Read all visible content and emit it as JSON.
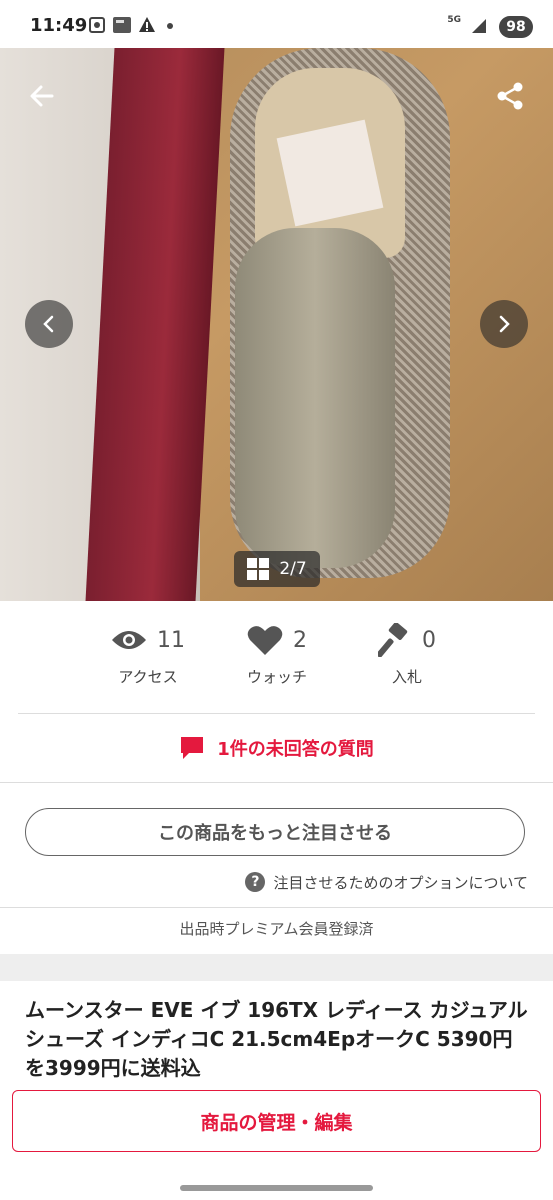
{
  "status_bar": {
    "time": "11:49",
    "network": "5G",
    "battery": "98"
  },
  "gallery": {
    "counter": "2/7",
    "icons": {
      "back": "arrow-left-icon",
      "share": "share-icon",
      "prev": "chevron-left-icon",
      "next": "chevron-right-icon",
      "grid": "grid-icon"
    }
  },
  "stats": {
    "access": {
      "count": "11",
      "label": "アクセス",
      "icon": "eye-icon"
    },
    "watch": {
      "count": "2",
      "label": "ウォッチ",
      "icon": "heart-icon"
    },
    "bids": {
      "count": "0",
      "label": "入札",
      "icon": "gavel-icon"
    }
  },
  "question_link": "1件の未回答の質問",
  "promote_button": "この商品をもっと注目させる",
  "promote_options_link": "注目させるためのオプションについて",
  "premium_note": "出品時プレミアム会員登録済",
  "item_title": "ムーンスター EVE イブ 196TX レディース カジュアルシューズ インディコC 21.5cm4EpオークC 5390円を3999円に送料込",
  "manage_button": "商品の管理・編集",
  "colors": {
    "accent": "#e4193e",
    "text": "#333333",
    "icon_gray": "#555555"
  }
}
